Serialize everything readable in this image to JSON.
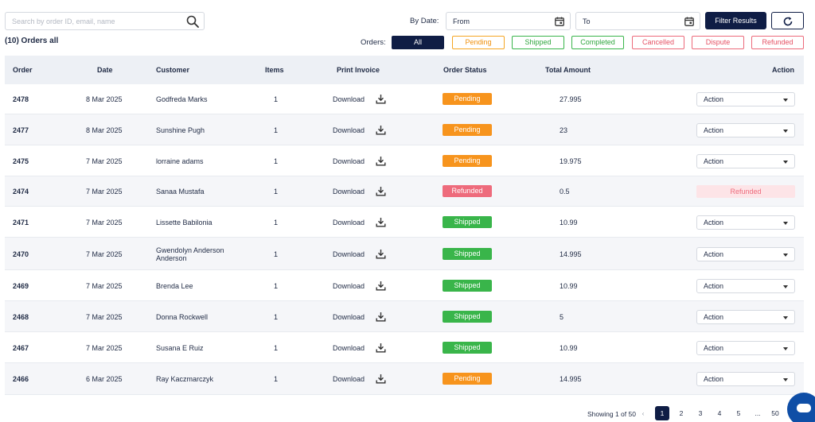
{
  "search": {
    "placeholder": "Search by order ID, email, name",
    "icon": "search-icon"
  },
  "date_filter": {
    "label": "By Date:",
    "from_placeholder": "From",
    "to_placeholder": "To"
  },
  "filter_button": "Filter Results",
  "orders_summary": "(10) Orders all",
  "status_filter": {
    "label": "Orders:",
    "chips": [
      "All",
      "Pending",
      "Shipped",
      "Completed",
      "Cancelled",
      "Dispute",
      "Refunded"
    ]
  },
  "table": {
    "headers": {
      "order": "Order",
      "date": "Date",
      "customer": "Customer",
      "items": "Items",
      "invoice": "Print Invoice",
      "status": "Order Status",
      "total": "Total Amount",
      "action": "Action"
    },
    "download_label": "Download",
    "action_label": "Action",
    "rows": [
      {
        "order": "2478",
        "date": "8 Mar 2025",
        "customer": "Godfreda Marks",
        "items": "1",
        "status": "Pending",
        "total": "27.995",
        "action": "Action"
      },
      {
        "order": "2477",
        "date": "8 Mar 2025",
        "customer": "Sunshine Pugh",
        "items": "1",
        "status": "Pending",
        "total": "23",
        "action": "Action"
      },
      {
        "order": "2475",
        "date": "7 Mar 2025",
        "customer": "lorraine adams",
        "items": "1",
        "status": "Pending",
        "total": "19.975",
        "action": "Action"
      },
      {
        "order": "2474",
        "date": "7 Mar 2025",
        "customer": "Sanaa Mustafa",
        "items": "1",
        "status": "Refunded",
        "total": "0.5",
        "action": "Refunded"
      },
      {
        "order": "2471",
        "date": "7 Mar 2025",
        "customer": "Lissette Babilonia",
        "items": "1",
        "status": "Shipped",
        "total": "10.99",
        "action": "Action"
      },
      {
        "order": "2470",
        "date": "7 Mar 2025",
        "customer": "Gwendolyn Anderson Anderson",
        "items": "1",
        "status": "Shipped",
        "total": "14.995",
        "action": "Action"
      },
      {
        "order": "2469",
        "date": "7 Mar 2025",
        "customer": "Brenda Lee",
        "items": "1",
        "status": "Shipped",
        "total": "10.99",
        "action": "Action"
      },
      {
        "order": "2468",
        "date": "7 Mar 2025",
        "customer": "Donna Rockwell",
        "items": "1",
        "status": "Shipped",
        "total": "5",
        "action": "Action"
      },
      {
        "order": "2467",
        "date": "7 Mar 2025",
        "customer": "Susana E Ruiz",
        "items": "1",
        "status": "Shipped",
        "total": "10.99",
        "action": "Action"
      },
      {
        "order": "2466",
        "date": "6 Mar 2025",
        "customer": "Ray Kaczmarczyk",
        "items": "1",
        "status": "Pending",
        "total": "14.995",
        "action": "Action"
      }
    ]
  },
  "pagination": {
    "info": "Showing 1 of 50",
    "prev": "‹",
    "pages": [
      "1",
      "2",
      "3",
      "4",
      "5",
      "...",
      "50"
    ],
    "active": "1"
  },
  "colors": {
    "primary": "#0f1d45",
    "pending": "#f7941d",
    "shipped": "#39b54a",
    "refunded": "#ee6b7c",
    "chat": "#0f4ea6"
  }
}
